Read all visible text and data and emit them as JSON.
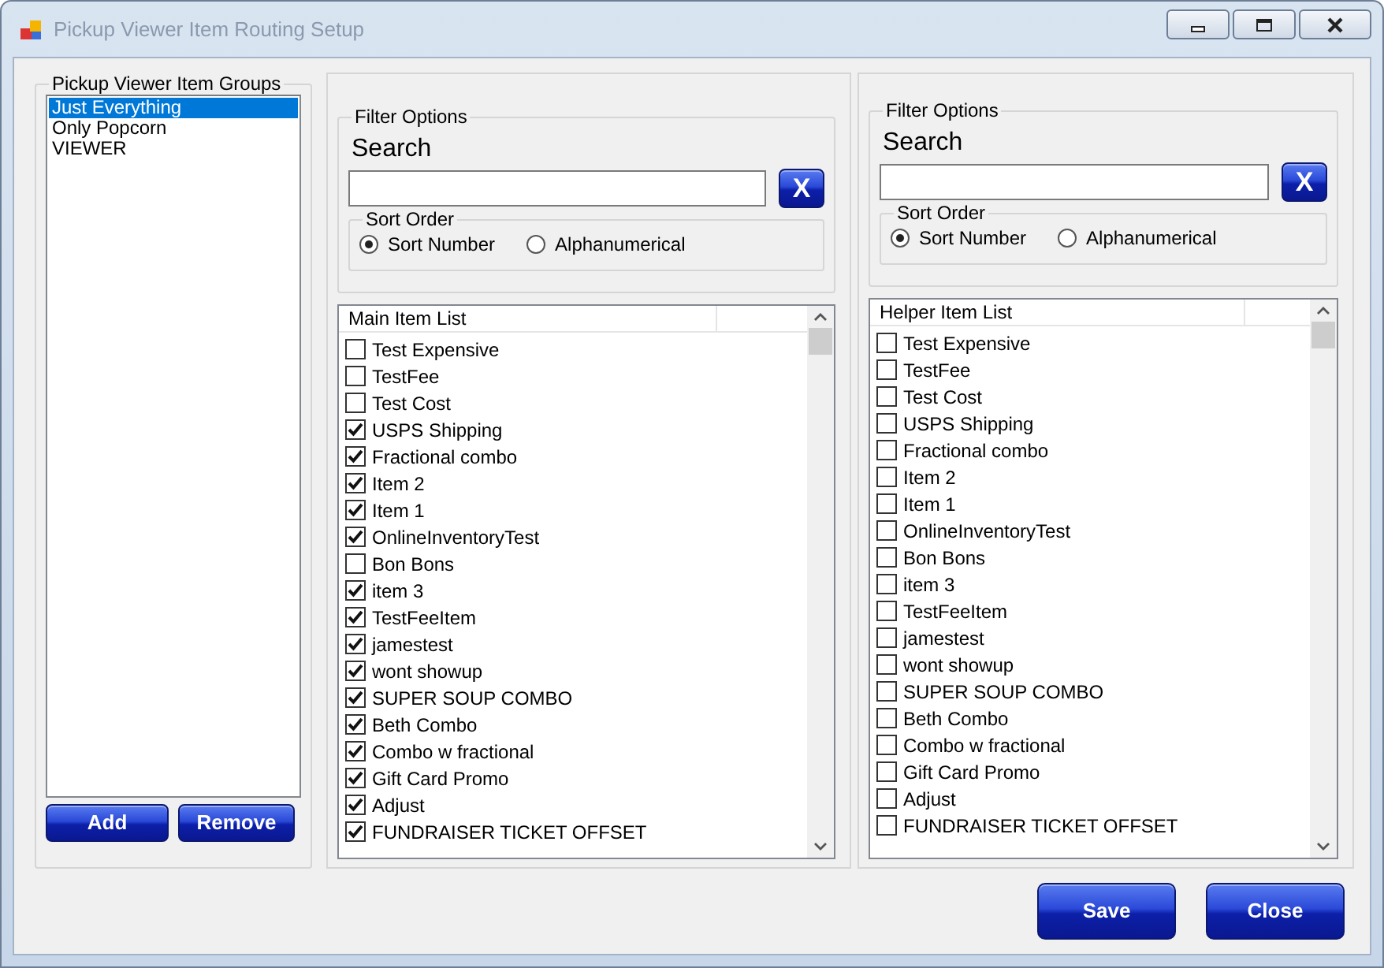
{
  "window": {
    "title": "Pickup Viewer Item Routing Setup"
  },
  "groups": {
    "title": "Pickup Viewer Item Groups",
    "items": [
      {
        "label": "Just Everything",
        "selected": true
      },
      {
        "label": "Only Popcorn",
        "selected": false
      },
      {
        "label": "VIEWER",
        "selected": false
      }
    ],
    "buttons": [
      "Add",
      "Remove"
    ]
  },
  "panels": [
    {
      "filter_title": "Filter Options",
      "search_label": "Search",
      "clear_button": "X",
      "sort_title": "Sort Order",
      "sort_options": [
        {
          "label": "Sort Number",
          "selected": true
        },
        {
          "label": "Alphanumerical",
          "selected": false
        }
      ],
      "list_header": "Main Item List",
      "items": [
        {
          "label": "Test Expensive",
          "checked": false
        },
        {
          "label": "TestFee",
          "checked": false
        },
        {
          "label": "Test Cost",
          "checked": false
        },
        {
          "label": "USPS Shipping",
          "checked": true
        },
        {
          "label": "Fractional combo",
          "checked": true
        },
        {
          "label": "Item 2",
          "checked": true
        },
        {
          "label": "Item 1",
          "checked": true
        },
        {
          "label": "OnlineInventoryTest",
          "checked": true
        },
        {
          "label": "Bon Bons",
          "checked": false
        },
        {
          "label": "item 3",
          "checked": true
        },
        {
          "label": "TestFeeItem",
          "checked": true
        },
        {
          "label": "jamestest",
          "checked": true
        },
        {
          "label": "wont showup",
          "checked": true
        },
        {
          "label": "SUPER SOUP COMBO",
          "checked": true
        },
        {
          "label": "Beth Combo",
          "checked": true
        },
        {
          "label": "Combo w fractional",
          "checked": true
        },
        {
          "label": "Gift Card Promo",
          "checked": true
        },
        {
          "label": "Adjust",
          "checked": true
        },
        {
          "label": "FUNDRAISER TICKET OFFSET",
          "checked": true
        }
      ]
    },
    {
      "filter_title": "Filter Options",
      "search_label": "Search",
      "clear_button": "X",
      "sort_title": "Sort Order",
      "sort_options": [
        {
          "label": "Sort Number",
          "selected": true
        },
        {
          "label": "Alphanumerical",
          "selected": false
        }
      ],
      "list_header": "Helper Item List",
      "items": [
        {
          "label": "Test Expensive",
          "checked": false
        },
        {
          "label": "TestFee",
          "checked": false
        },
        {
          "label": "Test Cost",
          "checked": false
        },
        {
          "label": "USPS Shipping",
          "checked": false
        },
        {
          "label": "Fractional combo",
          "checked": false
        },
        {
          "label": "Item 2",
          "checked": false
        },
        {
          "label": "Item 1",
          "checked": false
        },
        {
          "label": "OnlineInventoryTest",
          "checked": false
        },
        {
          "label": "Bon Bons",
          "checked": false
        },
        {
          "label": "item 3",
          "checked": false
        },
        {
          "label": "TestFeeItem",
          "checked": false
        },
        {
          "label": "jamestest",
          "checked": false
        },
        {
          "label": "wont showup",
          "checked": false
        },
        {
          "label": "SUPER SOUP COMBO",
          "checked": false
        },
        {
          "label": "Beth Combo",
          "checked": false
        },
        {
          "label": "Combo w fractional",
          "checked": false
        },
        {
          "label": "Gift Card Promo",
          "checked": false
        },
        {
          "label": "Adjust",
          "checked": false
        },
        {
          "label": "FUNDRAISER TICKET OFFSET",
          "checked": false
        }
      ]
    }
  ],
  "buttons": [
    "Save",
    "Close"
  ]
}
